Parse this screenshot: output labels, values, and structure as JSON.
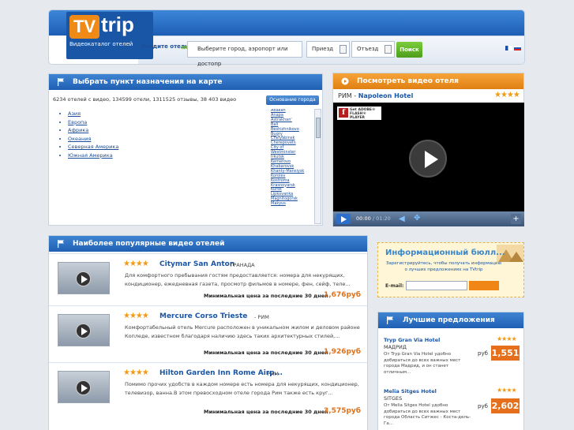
{
  "brand": {
    "logo_tv": "TV",
    "logo_trip": "trip",
    "tagline": "Видеокаталог отелей"
  },
  "search": {
    "label": "Найдите отель",
    "placeholder": "Выберите город, аэропорт или достопр",
    "checkin": "Приезд",
    "checkout": "Отъезд",
    "button": "Поиск"
  },
  "map_panel": {
    "title": "Выбрать пункт назначения на карте",
    "counts": "6234 отелей с видео, 134599 отели, 1311525 отзывы, 38 403 видео",
    "base_city_button": "Основание города",
    "regions": [
      "Азия",
      "Европа",
      "Африка",
      "Океания",
      "Северная Америка",
      "Южная Америка"
    ],
    "cities": [
      "Abakan",
      "Anapa",
      "Astrakhan'",
      "Bali",
      "Beshizhnikovo",
      "Bugry",
      "Chelyabinsk",
      "Cherepovets",
      "City of",
      "Westminster",
      "Irkutsk",
      "Kemerovo",
      "Khabarovsk",
      "Khanty-Mansiysk",
      "Korolev",
      "Kostroma",
      "Krasnoyarsk",
      "Kursk",
      "Lipkovanka",
      "Magnitogorsk",
      "Makyus"
    ]
  },
  "video_panel": {
    "title": "Посмотреть видео отеля",
    "city": "РИМ - ",
    "hotel": "Napoleon Hotel",
    "stars": "★★★★",
    "flash_get": "Get ADOBE®",
    "flash_player": "FLASH® PLAYER",
    "time_current": "00:00",
    "time_total": "/ 01:20"
  },
  "popular": {
    "title": "Наиболее популярные видео отелей",
    "price_label": "Минимальная цена за последние 30 дней",
    "hotels": [
      {
        "stars": "★★★★",
        "name": "Citymar San Anton",
        "city": "- ГРАНАДА",
        "desc": "Для комфортного пребывания гостям предоставляется: номера для некурящих, кондиционер, ежедневная газета, просмотр фильмов в номере, фен, сейф, теле...",
        "price": "1,676руб"
      },
      {
        "stars": "★★★★",
        "name": "Mercure Corso Trieste",
        "city": "- РИМ",
        "desc": "Комфортабельный отель Mercure расположен в уникальном жилом и деловом районе Копледе, известном благодаря наличию здесь таких архитектурных стилей,...",
        "price": "1,926руб"
      },
      {
        "stars": "★★★★",
        "name": "Hilton Garden Inn Rome Airp...",
        "city": "- РИМ",
        "desc": "Помимо прочих удобств в каждом номере есть номера для некурящих, кондиционер, телевизор, ванна.В этом превосходном отеле города Рим также есть круг...",
        "price": "3,575руб"
      }
    ]
  },
  "info": {
    "title": "Информационный бюлл...",
    "text": "Зарегистрируйтесь, чтобы получать информацию о лучших предложениях на TVtrip",
    "email_label": "E-mail:"
  },
  "deals": {
    "title": "Лучшие предложения",
    "currency": "руб",
    "items": [
      {
        "name": "Tryp Gran Via Hotel",
        "stars": "★★★★",
        "city": "МАДРИД",
        "desc": "От Tryp Gran Via Hotel удобно добираться до всех важных мест города Мадрид, и он станет отличным...",
        "price": "1,551"
      },
      {
        "name": "Melia Sitges Hotel",
        "stars": "★★★★",
        "city": "SITGES",
        "desc": "От Melia Sitges Hotel удобно добираться до всех важных мест города Область Ситжес - Коста-дель-Га...",
        "price": "2,602"
      }
    ]
  }
}
